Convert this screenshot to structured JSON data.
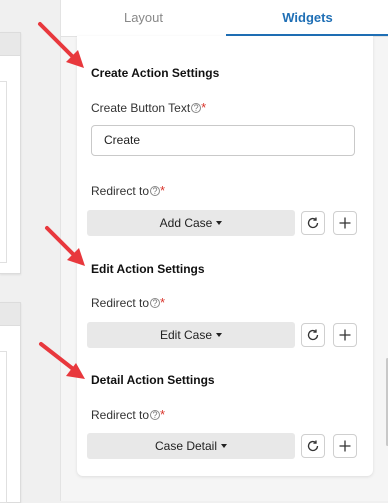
{
  "tabs": [
    {
      "label": "Layout",
      "active": false
    },
    {
      "label": "Widgets",
      "active": true
    }
  ],
  "sections": {
    "create": {
      "title": "Create Action Settings",
      "button_text_label": "Create Button Text",
      "button_text_value": "Create",
      "redirect_label": "Redirect to",
      "redirect_value": "Add Case"
    },
    "edit": {
      "title": "Edit Action Settings",
      "redirect_label": "Redirect to",
      "redirect_value": "Edit Case"
    },
    "detail": {
      "title": "Detail Action Settings",
      "redirect_label": "Redirect to",
      "redirect_value": "Case Detail"
    }
  },
  "icons": {
    "help": "question-circle-icon",
    "required": "asterisk",
    "refresh": "refresh-icon",
    "add": "plus-icon",
    "annotation": "red-arrow"
  },
  "colors": {
    "accent": "#1f6fb5",
    "required": "#d9342b",
    "annotation_arrow": "#e8383d"
  }
}
